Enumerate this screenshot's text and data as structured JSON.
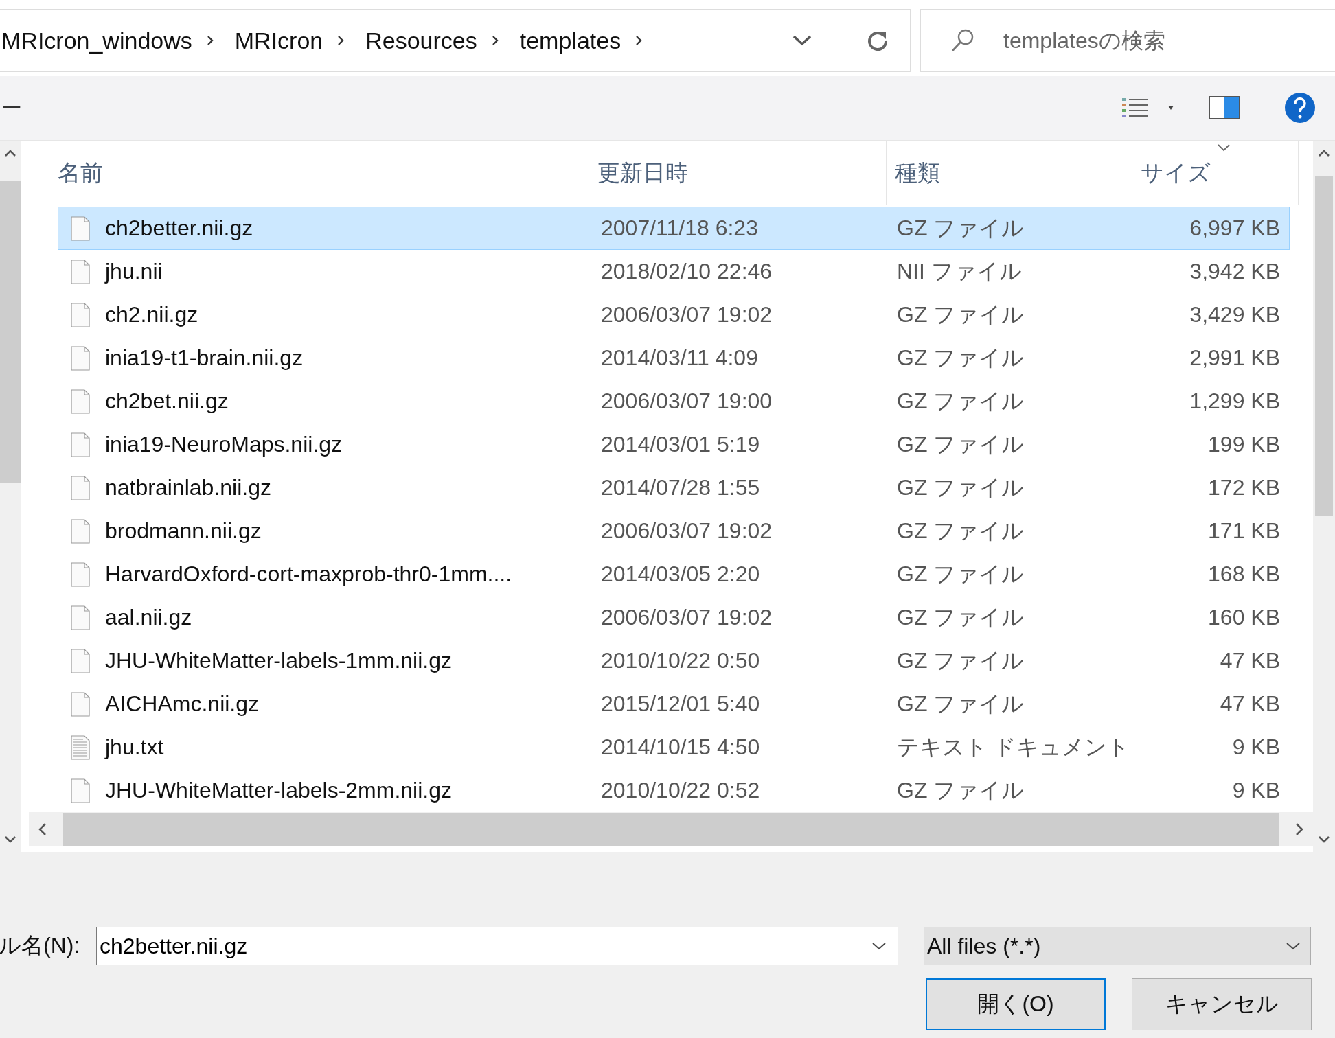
{
  "breadcrumb": [
    "MRIcron_windows",
    "MRIcron",
    "Resources",
    "templates"
  ],
  "search": {
    "placeholder": "templatesの検索"
  },
  "toolbar": {
    "new_folder_label": "ー"
  },
  "table": {
    "columns": [
      "名前",
      "更新日時",
      "種類",
      "サイズ"
    ],
    "rows": [
      {
        "name": "ch2better.nii.gz",
        "modified": "2007/11/18 6:23",
        "type": "GZ ファイル",
        "size": "6,997 KB",
        "kind": "file",
        "selected": true
      },
      {
        "name": "jhu.nii",
        "modified": "2018/02/10 22:46",
        "type": "NII ファイル",
        "size": "3,942 KB",
        "kind": "file",
        "selected": false
      },
      {
        "name": "ch2.nii.gz",
        "modified": "2006/03/07 19:02",
        "type": "GZ ファイル",
        "size": "3,429 KB",
        "kind": "file",
        "selected": false
      },
      {
        "name": "inia19-t1-brain.nii.gz",
        "modified": "2014/03/11 4:09",
        "type": "GZ ファイル",
        "size": "2,991 KB",
        "kind": "file",
        "selected": false
      },
      {
        "name": "ch2bet.nii.gz",
        "modified": "2006/03/07 19:00",
        "type": "GZ ファイル",
        "size": "1,299 KB",
        "kind": "file",
        "selected": false
      },
      {
        "name": "inia19-NeuroMaps.nii.gz",
        "modified": "2014/03/01 5:19",
        "type": "GZ ファイル",
        "size": "199 KB",
        "kind": "file",
        "selected": false
      },
      {
        "name": "natbrainlab.nii.gz",
        "modified": "2014/07/28 1:55",
        "type": "GZ ファイル",
        "size": "172 KB",
        "kind": "file",
        "selected": false
      },
      {
        "name": "brodmann.nii.gz",
        "modified": "2006/03/07 19:02",
        "type": "GZ ファイル",
        "size": "171 KB",
        "kind": "file",
        "selected": false
      },
      {
        "name": "HarvardOxford-cort-maxprob-thr0-1mm....",
        "modified": "2014/03/05 2:20",
        "type": "GZ ファイル",
        "size": "168 KB",
        "kind": "file",
        "selected": false
      },
      {
        "name": "aal.nii.gz",
        "modified": "2006/03/07 19:02",
        "type": "GZ ファイル",
        "size": "160 KB",
        "kind": "file",
        "selected": false
      },
      {
        "name": "JHU-WhiteMatter-labels-1mm.nii.gz",
        "modified": "2010/10/22 0:50",
        "type": "GZ ファイル",
        "size": "47 KB",
        "kind": "file",
        "selected": false
      },
      {
        "name": "AICHAmc.nii.gz",
        "modified": "2015/12/01 5:40",
        "type": "GZ ファイル",
        "size": "47 KB",
        "kind": "file",
        "selected": false
      },
      {
        "name": "jhu.txt",
        "modified": "2014/10/15 4:50",
        "type": "テキスト ドキュメント",
        "size": "9 KB",
        "kind": "text",
        "selected": false
      },
      {
        "name": "JHU-WhiteMatter-labels-2mm.nii.gz",
        "modified": "2010/10/22 0:52",
        "type": "GZ ファイル",
        "size": "9 KB",
        "kind": "file",
        "selected": false
      }
    ]
  },
  "filename": {
    "label": "ル名(N):",
    "value": "ch2better.nii.gz"
  },
  "filter": {
    "value": "All files (*.*)"
  },
  "buttons": [
    {
      "label": "開く(O)",
      "kind": "default"
    },
    {
      "label": "キャンセル",
      "kind": "normal"
    }
  ]
}
